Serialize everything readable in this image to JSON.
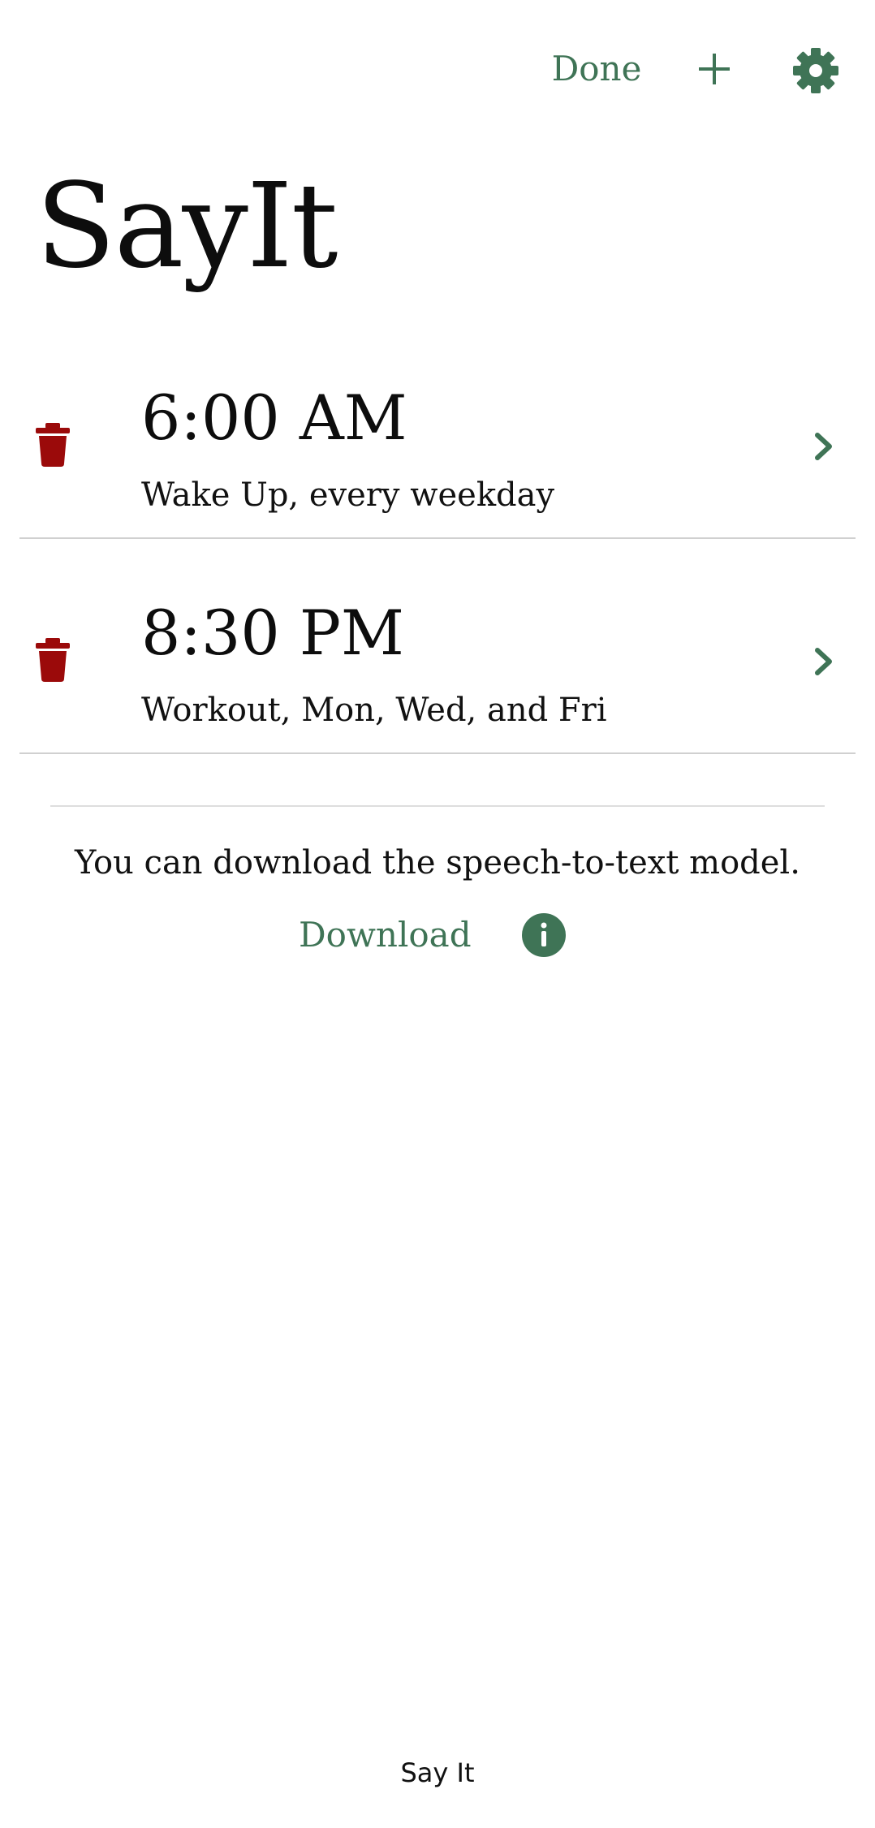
{
  "header": {
    "done_label": "Done",
    "add_icon": "plus-icon",
    "settings_icon": "gear-icon"
  },
  "app_title": "SayIt",
  "alarms": [
    {
      "time": "6:00 AM",
      "description": "Wake Up, every weekday"
    },
    {
      "time": "8:30 PM",
      "description": "Workout, Mon, Wed, and Fri"
    }
  ],
  "download_section": {
    "message": "You can download the speech-to-text model.",
    "download_label": "Download",
    "info_icon": "info-icon"
  },
  "footer": {
    "label": "Say It"
  },
  "colors": {
    "accent": "#3f7456",
    "delete": "#9b0a0a",
    "text": "#111111",
    "divider": "#d0d0d0"
  }
}
